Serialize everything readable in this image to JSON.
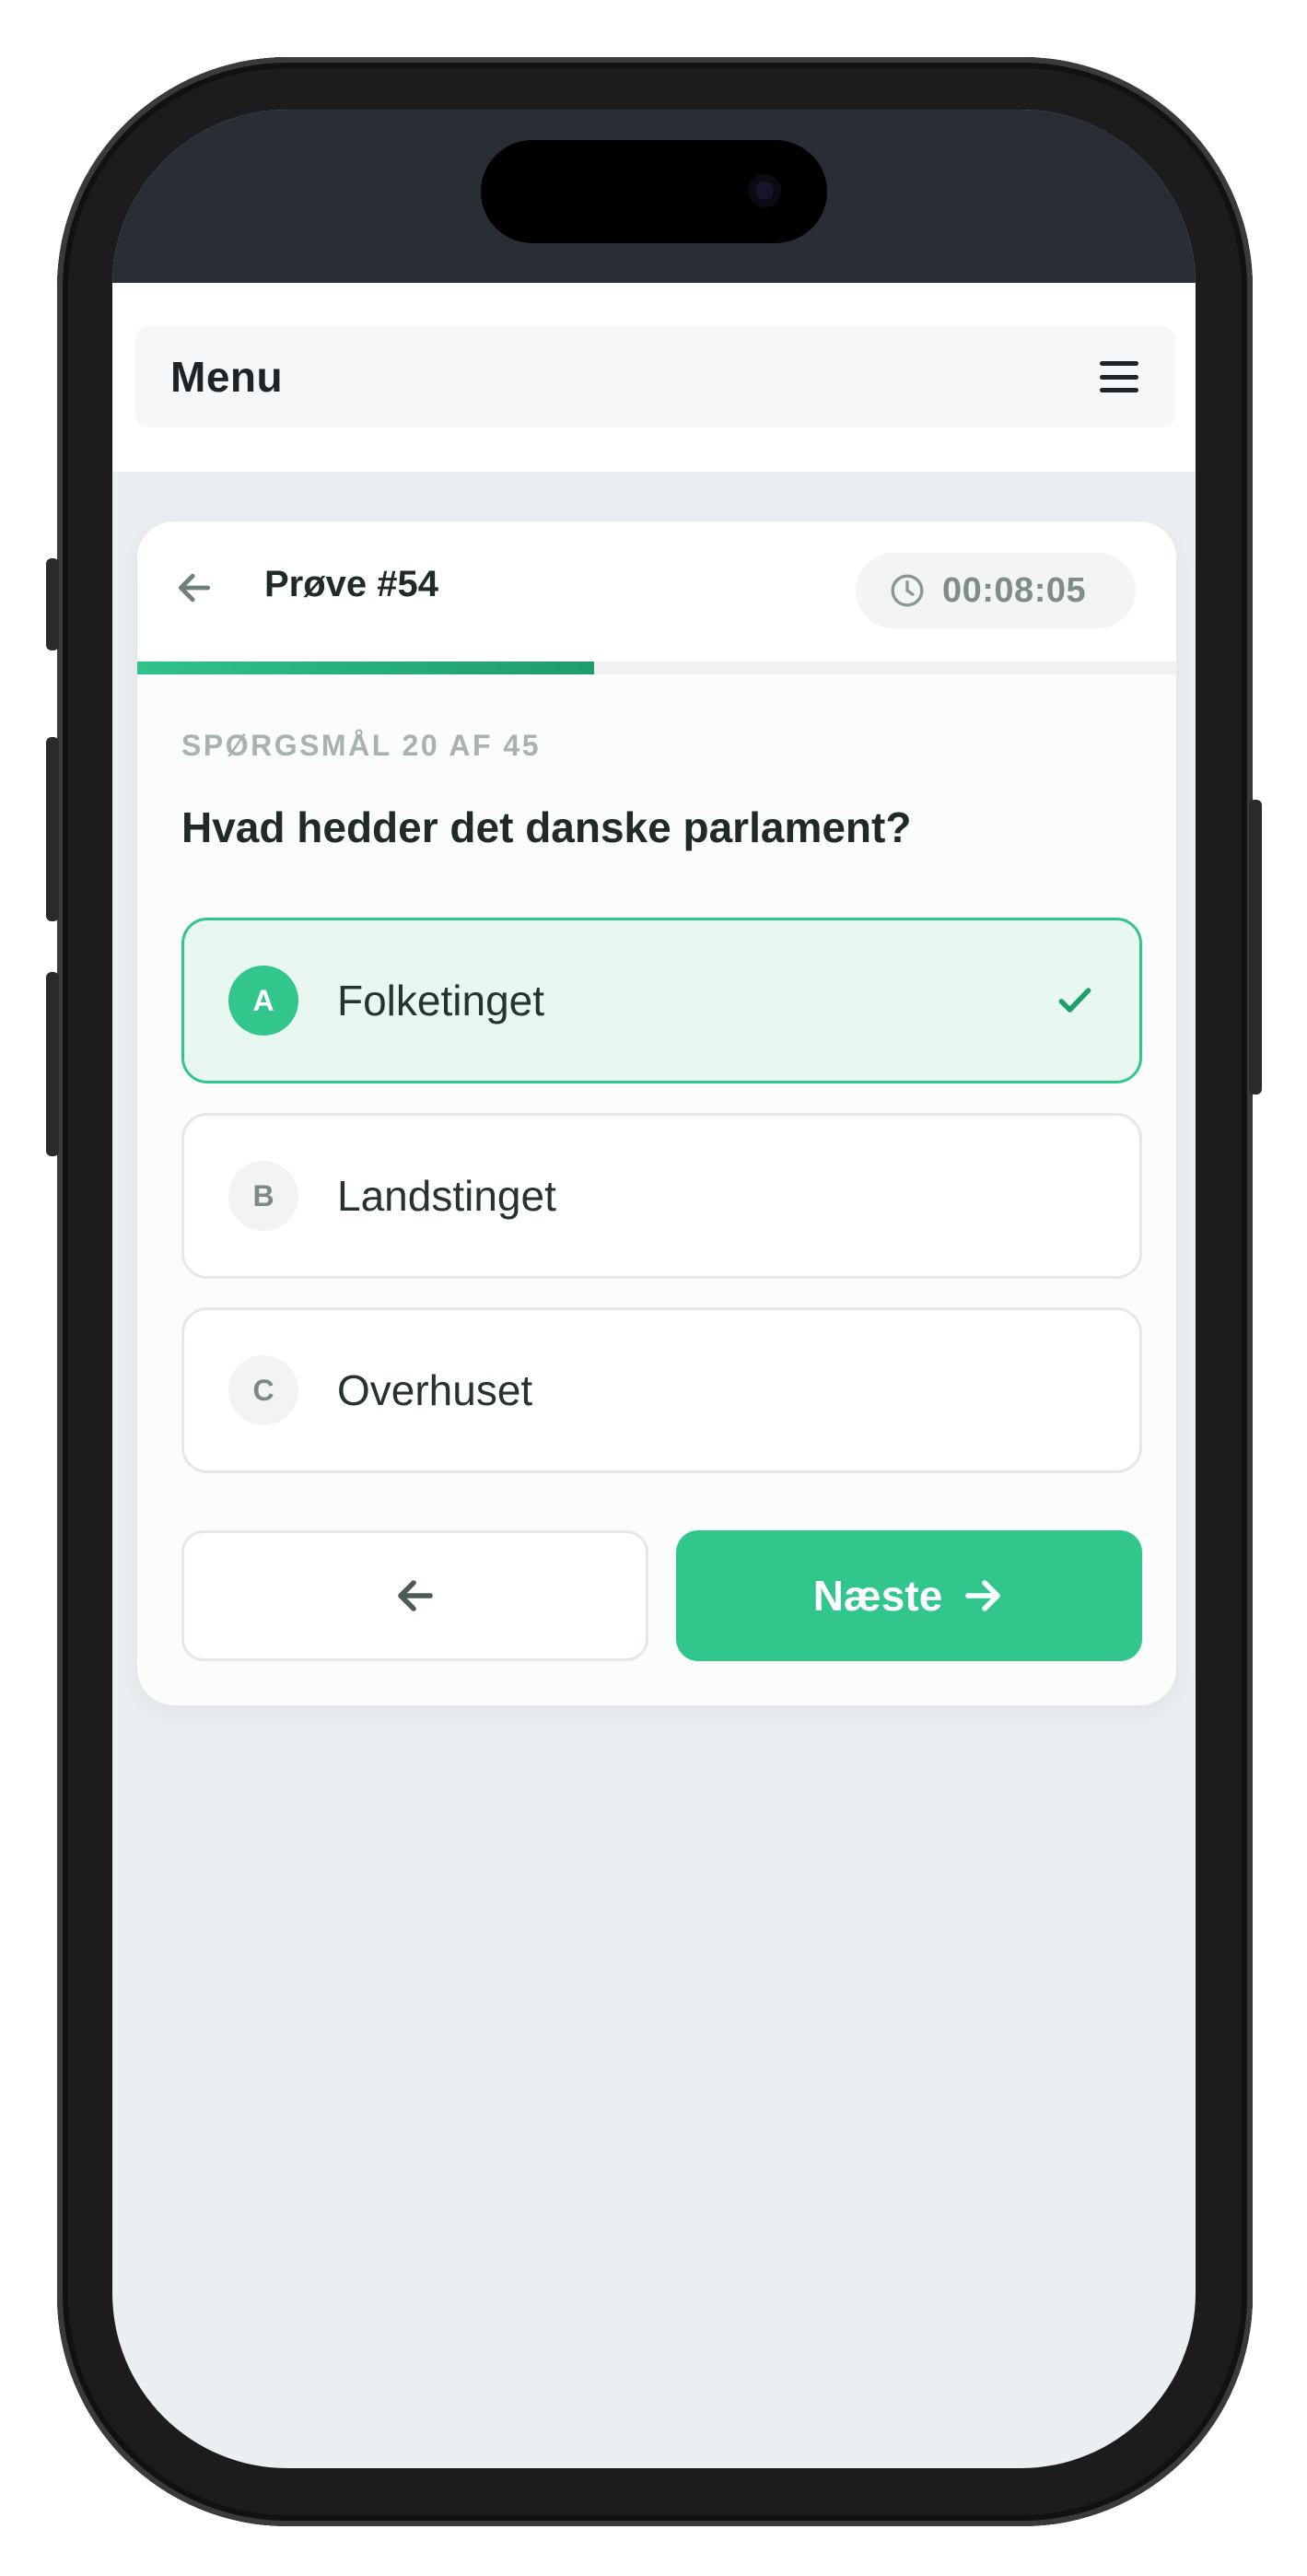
{
  "app_header": {
    "menu_label": "Menu",
    "menu_icon": "hamburger-icon"
  },
  "quiz": {
    "title": "Prøve #54",
    "timer": "00:08:05",
    "progress": 0.44,
    "question_counter": "SPØRGSMÅL 20 AF 45",
    "question": "Hvad hedder det danske parlament?",
    "options": [
      {
        "letter": "A",
        "label": "Folketinget",
        "selected": true
      },
      {
        "letter": "B",
        "label": "Landstinget",
        "selected": false
      },
      {
        "letter": "C",
        "label": "Overhuset",
        "selected": false
      }
    ],
    "next_label": "Næste"
  },
  "colors": {
    "accent": "#30c68c",
    "selected_bg": "#e8f8f1",
    "status_bar": "#292d36",
    "text_dark": "#1f2b28"
  }
}
